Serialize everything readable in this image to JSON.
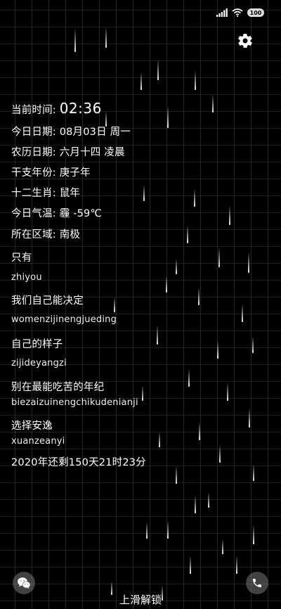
{
  "status": {
    "battery": "100"
  },
  "info": {
    "time_label": "当前时间:",
    "time_value": "02:36",
    "date": "今日日期: 08月03日 周一",
    "lunar": "农历日期: 六月十四  凌晨",
    "ganzhi": "干支年份: 庚子年",
    "zodiac": "十二生肖: 鼠年",
    "weather": "今日气温: 霾  -59℃",
    "region": "所在区域: 南极"
  },
  "lyrics": [
    {
      "text": "只有",
      "pinyin": "zhiyou"
    },
    {
      "text": "我们自己能决定",
      "pinyin": "womenzijinengjueding"
    },
    {
      "text": "自己的样子",
      "pinyin": "zijideyangzi"
    },
    {
      "text": "别在最能吃苦的年纪",
      "pinyin": "biezaizuinengchikudenianji"
    },
    {
      "text": "选择安逸",
      "pinyin": "xuanzeanyi"
    }
  ],
  "countdown": "2020年还剩150天21时23分",
  "bottom": {
    "unlock_label": "上滑解锁",
    "left_icon": "wechat-icon",
    "right_icon": "phone-icon"
  }
}
